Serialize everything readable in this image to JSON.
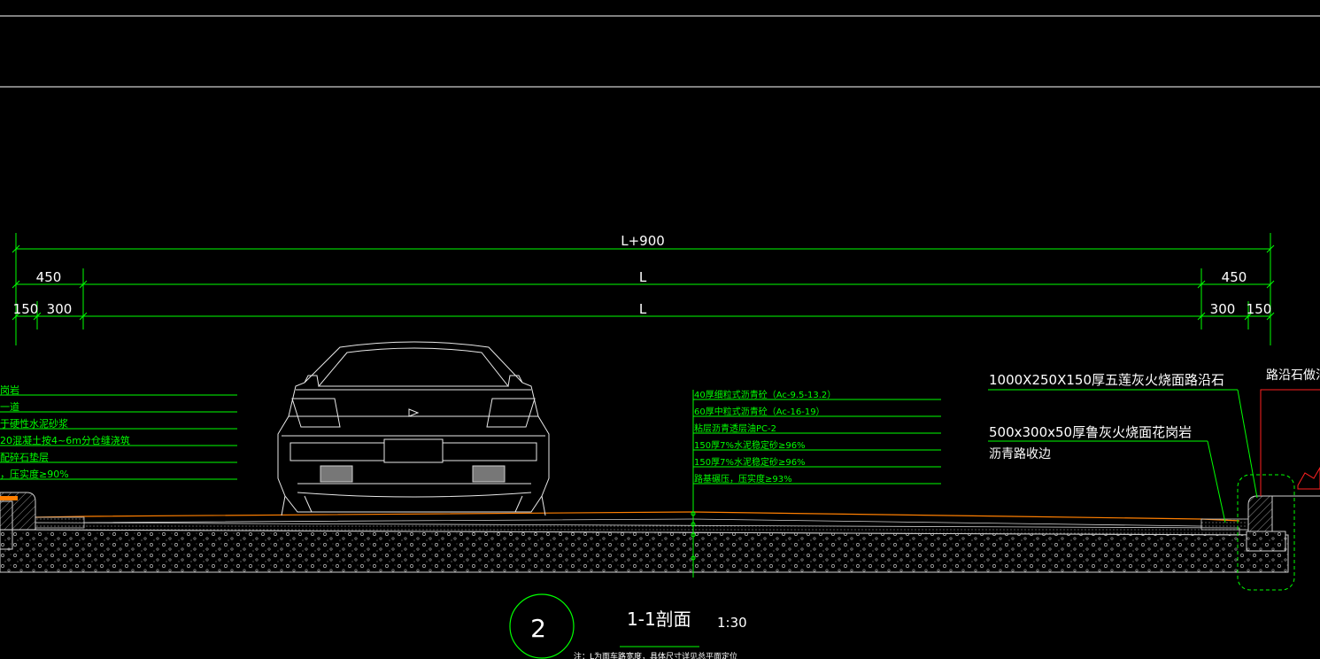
{
  "colors": {
    "background": "#000000",
    "dimension": "#00ff00",
    "annotation": "#00ff00",
    "line_white": "#ffffff",
    "surface_orange": "#ff7f00",
    "callout_red": "#ff2020"
  },
  "dimensions": {
    "overall": "L+900",
    "middle_top": "L",
    "middle_bottom": "L",
    "left_450": "450",
    "left_150": "150",
    "left_300": "300",
    "right_450": "450",
    "right_300": "300",
    "right_150": "150"
  },
  "left_layers": [
    "岗岩",
    "一道",
    "于硬性水泥砂浆",
    "20混凝土按4~6m分仓缝浇筑",
    "配碎石垫层",
    "，压实度≥90%"
  ],
  "center_layers": [
    "40厚细粒式沥青砼（Ac-9.5-13.2）",
    "60厚中粒式沥青砼（Ac-16-19）",
    "粘层沥青透层油PC-2",
    "150厚7%水泥稳定砂≥96%",
    "150厚7%水泥稳定砂≥96%",
    "路基碾压，压实度≥93%"
  ],
  "right_notes": {
    "curb": "1000X250X150厚五莲灰火烧面路沿石",
    "edge": "500x300x50厚鲁灰火烧面花岗岩",
    "edge_sub": "沥青路收边",
    "detail_ref": "路沿石做法"
  },
  "section": {
    "number": "2",
    "title": "1-1剖面",
    "scale": "1:30",
    "note": "注：L为面车路宽度，具体尺寸详见总平面定位"
  }
}
